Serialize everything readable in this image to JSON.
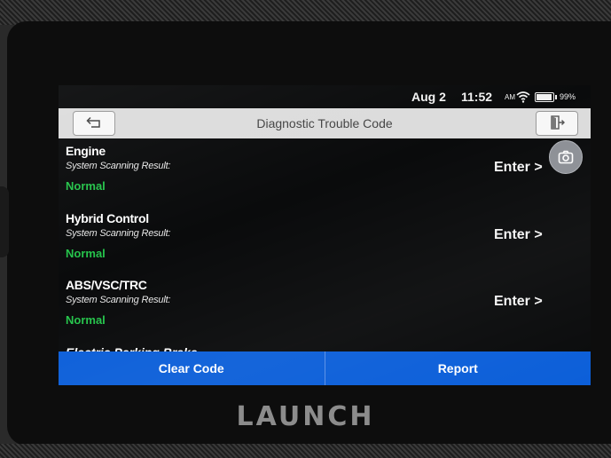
{
  "status_bar": {
    "date": "Aug 2",
    "time": "11:52",
    "ampm": "AM",
    "battery": "99%"
  },
  "title_bar": {
    "title": "Diagnostic Trouble Code"
  },
  "systems": [
    {
      "name": "Engine",
      "result_label": "System Scanning Result:",
      "result": "Normal",
      "action": "Enter >"
    },
    {
      "name": "Hybrid Control",
      "result_label": "System Scanning Result:",
      "result": "Normal",
      "action": "Enter >"
    },
    {
      "name": "ABS/VSC/TRC",
      "result_label": "System Scanning Result:",
      "result": "Normal",
      "action": "Enter >"
    }
  ],
  "partial_entry": "Electric Parking Brake",
  "bottom_bar": {
    "clear_code": "Clear Code",
    "report": "Report"
  },
  "device_brand": "LAUNCH",
  "colors": {
    "accent_blue": "#0c5fd9",
    "normal_green": "#25c44b",
    "title_bar": "#dcdcdc"
  },
  "icons": {
    "back": "back-arrow-icon",
    "exit": "exit-door-icon",
    "camera": "camera-icon",
    "wifi": "wifi-icon",
    "battery": "battery-icon"
  }
}
